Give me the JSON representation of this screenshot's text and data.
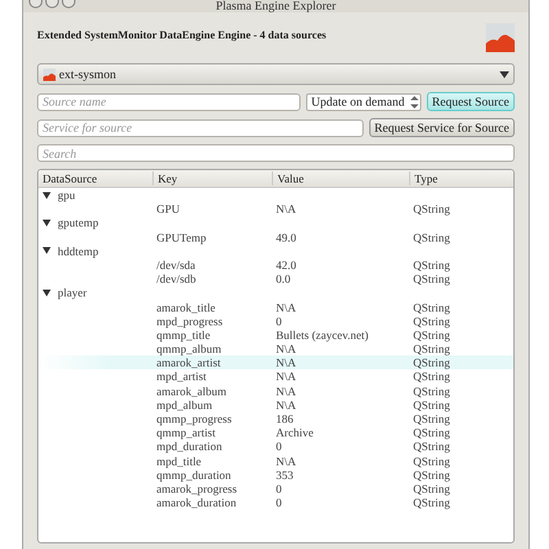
{
  "window": {
    "title": "Plasma Engine Explorer"
  },
  "header": {
    "title": "Extended SystemMonitor DataEngine Engine - 4 data sources"
  },
  "engine_select": {
    "value": "ext-sysmon"
  },
  "source_field": {
    "placeholder": "Source name"
  },
  "update_spin": {
    "value": "Update on demand"
  },
  "request_source_button": {
    "label": "Request Source",
    "focused": true
  },
  "service_field": {
    "placeholder": "Service for source"
  },
  "request_service_button": {
    "label": "Request Service for Source"
  },
  "search_field": {
    "placeholder": "Search"
  },
  "tree": {
    "columns": [
      "DataSource",
      "Key",
      "Value",
      "Type"
    ],
    "groups": [
      {
        "name": "gpu",
        "expanded": true,
        "children": [
          {
            "key": "GPU",
            "value": " N\\A",
            "type": "QString",
            "highlighted": false
          }
        ]
      },
      {
        "name": "gputemp",
        "expanded": true,
        "children": [
          {
            "key": "GPUTemp",
            "value": "49.0",
            "type": "QString",
            "highlighted": false
          }
        ]
      },
      {
        "name": "hddtemp",
        "expanded": true,
        "children": [
          {
            "key": "/dev/sda",
            "value": "42.0",
            "type": "QString",
            "highlighted": false
          },
          {
            "key": "/dev/sdb",
            "value": " 0.0",
            "type": "QString",
            "highlighted": false
          }
        ]
      },
      {
        "name": "player",
        "expanded": true,
        "children": [
          {
            "key": "amarok_title",
            "value": "N\\A",
            "type": "QString",
            "highlighted": false
          },
          {
            "key": "mpd_progress",
            "value": "0",
            "type": "QString",
            "highlighted": false
          },
          {
            "key": "qmmp_title",
            "value": "Bullets (zaycev.net)",
            "type": "QString",
            "highlighted": false
          },
          {
            "key": "qmmp_album",
            "value": "N\\A",
            "type": "QString",
            "highlighted": false
          },
          {
            "key": "amarok_artist",
            "value": "N\\A",
            "type": "QString",
            "highlighted": true
          },
          {
            "key": "mpd_artist",
            "value": "N\\A",
            "type": "QString",
            "highlighted": false
          },
          {
            "key": "amarok_album",
            "value": "N\\A",
            "type": "QString",
            "highlighted": false
          },
          {
            "key": "mpd_album",
            "value": "N\\A",
            "type": "QString",
            "highlighted": false
          },
          {
            "key": "qmmp_progress",
            "value": "186",
            "type": "QString",
            "highlighted": false
          },
          {
            "key": "qmmp_artist",
            "value": "Archive",
            "type": "QString",
            "highlighted": false
          },
          {
            "key": "mpd_duration",
            "value": "0",
            "type": "QString",
            "highlighted": false
          },
          {
            "key": "mpd_title",
            "value": "N\\A",
            "type": "QString",
            "highlighted": false
          },
          {
            "key": "qmmp_duration",
            "value": "353",
            "type": "QString",
            "highlighted": false
          },
          {
            "key": "amarok_progress",
            "value": "0",
            "type": "QString",
            "highlighted": false
          },
          {
            "key": "amarok_duration",
            "value": "0",
            "type": "QString",
            "highlighted": false
          }
        ]
      }
    ]
  }
}
